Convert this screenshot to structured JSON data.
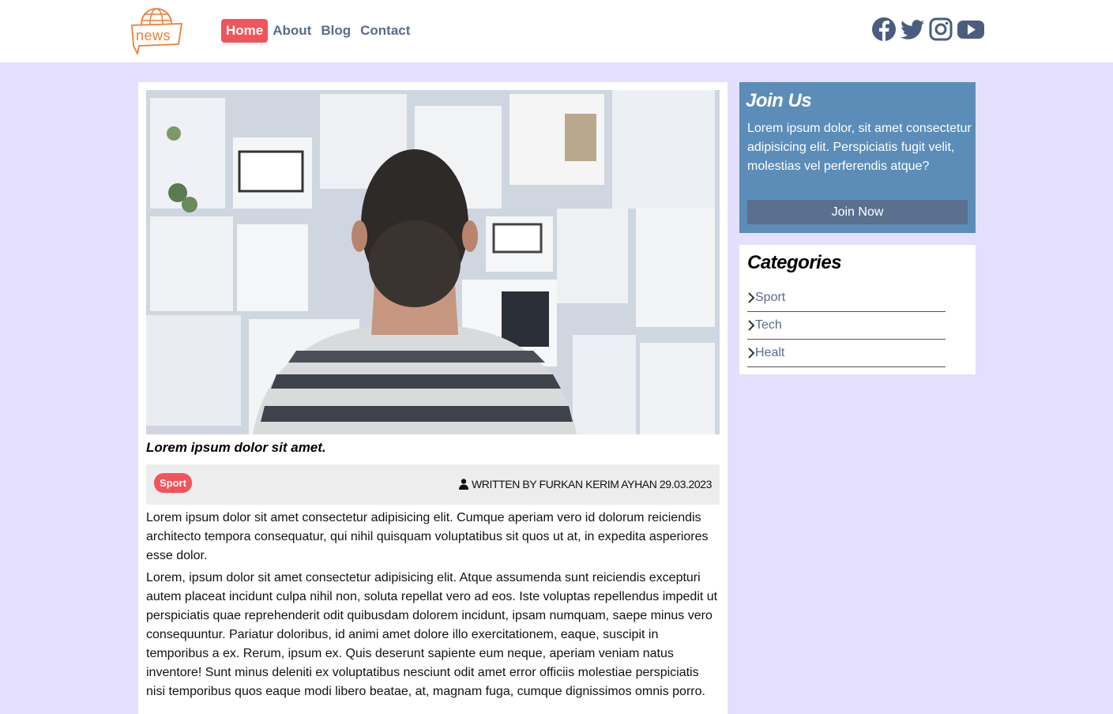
{
  "header": {
    "logo_text": "news",
    "nav": [
      {
        "label": "Home",
        "active": true
      },
      {
        "label": "About",
        "active": false
      },
      {
        "label": "Blog",
        "active": false
      },
      {
        "label": "Contact",
        "active": false
      }
    ],
    "social_icons": [
      "facebook-icon",
      "twitter-icon",
      "instagram-icon",
      "youtube-icon"
    ]
  },
  "article": {
    "title": "Lorem ipsum dolor sit amet.",
    "category_badge": "Sport",
    "byline": "WRITTEN BY FURKAN KERIM AYHAN 29.03.2023",
    "paragraphs": [
      "Lorem ipsum dolor sit amet consectetur adipisicing elit. Cumque aperiam vero id dolorum reiciendis architecto tempora consequatur, qui nihil quisquam voluptatibus sit quos ut at, in expedita asperiores esse dolor.",
      "Lorem, ipsum dolor sit amet consectetur adipisicing elit. Atque assumenda sunt reiciendis excepturi autem placeat incidunt culpa nihil non, soluta repellat vero ad eos. Iste voluptas repellendus impedit ut perspiciatis quae reprehenderit odit quibusdam dolorem incidunt, ipsam numquam, saepe minus vero consequuntur. Pariatur doloribus, id animi amet dolore illo exercitationem, eaque, suscipit in temporibus a ex. Rerum, ipsum ex. Quis deserunt sapiente eum neque, aperiam veniam natus inventore! Sunt minus deleniti ex voluptatibus nesciunt odit amet error officiis molestiae perspiciatis nisi temporibus quos eaque modi libero beatae, at, magnam fuga, cumque dignissimos omnis porro."
    ]
  },
  "sidebar": {
    "join": {
      "title": "Join Us",
      "text": "Lorem ipsum dolor, sit amet consectetur adipisicing elit. Perspiciatis fugit velit, molestias vel perferendis atque?",
      "button_label": "Join Now"
    },
    "categories": {
      "title": "Categories",
      "items": [
        "Sport",
        "Tech",
        "Healt"
      ]
    }
  },
  "colors": {
    "page_bg": "#e3dffd",
    "accent": "#f2545b",
    "join_bg": "#5b8db8",
    "join_button": "#5b6f8e",
    "logo": "#ef7d35",
    "nav_text": "#5a6b8a"
  }
}
